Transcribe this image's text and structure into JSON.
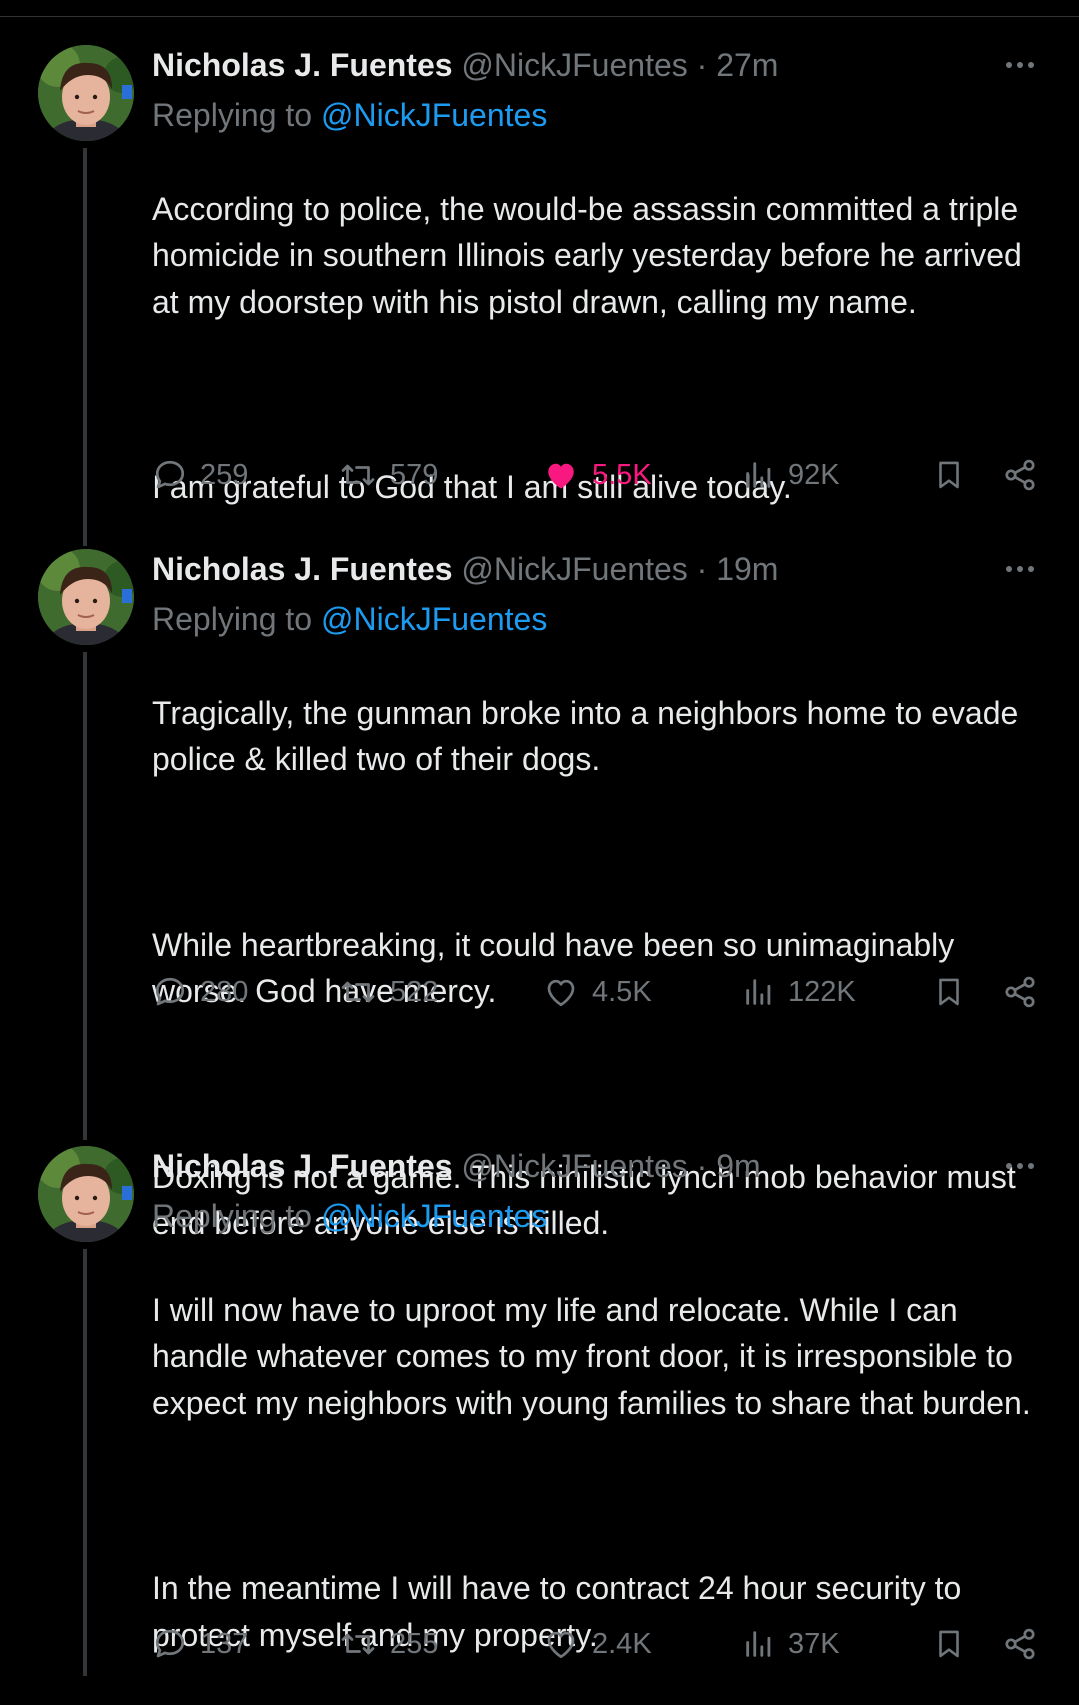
{
  "tweets": [
    {
      "author_name": "Nicholas J. Fuentes",
      "author_handle": "@NickJFuentes",
      "separator": "·",
      "timestamp": "27m",
      "replying_prefix": "Replying to",
      "replying_to": "@NickJFuentes",
      "paragraphs": [
        "According to police, the would-be assassin committed a triple homicide in southern Illinois early yesterday before he arrived at my doorstep with his pistol drawn, calling my name.",
        "I am grateful to God that I am still alive today."
      ],
      "stats": {
        "replies": "259",
        "retweets": "579",
        "likes": "5.5K",
        "views": "92K"
      },
      "liked": true
    },
    {
      "author_name": "Nicholas J. Fuentes",
      "author_handle": "@NickJFuentes",
      "separator": "·",
      "timestamp": "19m",
      "replying_prefix": "Replying to",
      "replying_to": "@NickJFuentes",
      "paragraphs": [
        "Tragically, the gunman broke into a neighbors home to evade police & killed two of their dogs.",
        "While heartbreaking, it could have been so unimaginably worse. God have mercy.",
        "Doxing is not a game. This nihilistic lynch mob behavior must end before anyone else is killed."
      ],
      "stats": {
        "replies": "280",
        "retweets": "522",
        "likes": "4.5K",
        "views": "122K"
      },
      "liked": false
    },
    {
      "author_name": "Nicholas J. Fuentes",
      "author_handle": "@NickJFuentes",
      "separator": "·",
      "timestamp": "9m",
      "replying_prefix": "Replying to",
      "replying_to": "@NickJFuentes",
      "paragraphs": [
        "I will now have to uproot my life and relocate. While I can handle whatever comes to my front door, it is irresponsible to expect my neighbors with young families to share that burden.",
        "In the meantime I will have to contract 24 hour security to protect myself and my property."
      ],
      "stats": {
        "replies": "137",
        "retweets": "255",
        "likes": "2.4K",
        "views": "37K"
      },
      "liked": false
    }
  ],
  "icons": {
    "more": "more-dots-icon",
    "reply": "reply-bubble-icon",
    "retweet": "retweet-icon",
    "like": "heart-icon",
    "views": "views-bars-icon",
    "bookmark": "bookmark-icon",
    "share": "share-icon"
  },
  "colors": {
    "background": "#000000",
    "text_primary": "#e7e9ea",
    "text_secondary": "#71767b",
    "link": "#1d9bf0",
    "like_active": "#f91880",
    "thread_line": "#333639"
  }
}
